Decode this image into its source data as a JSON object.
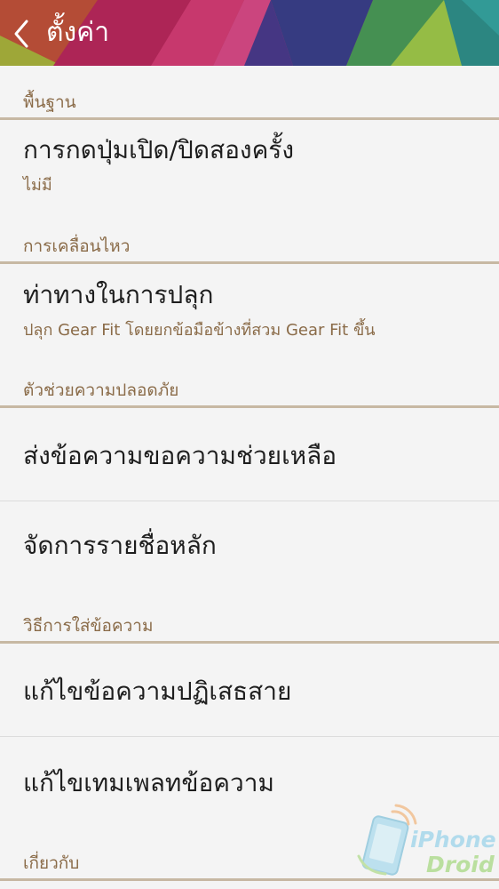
{
  "header": {
    "title": "ตั้งค่า",
    "back_icon": "chevron-left-icon"
  },
  "sections": [
    {
      "label": "พื้นฐาน",
      "items": [
        {
          "title": "การกดปุ่มเปิด/ปิดสองครั้ง",
          "subtitle": "ไม่มี"
        }
      ]
    },
    {
      "label": "การเคลื่อนไหว",
      "items": [
        {
          "title": "ท่าทางในการปลุก",
          "subtitle": "ปลุก Gear Fit โดยยกข้อมือข้างที่สวม Gear Fit ขึ้น"
        }
      ]
    },
    {
      "label": "ตัวช่วยความปลอดภัย",
      "items": [
        {
          "title": "ส่งข้อความขอความช่วยเหลือ"
        },
        {
          "title": "จัดการรายชื่อหลัก"
        }
      ]
    },
    {
      "label": "วิธีการใส่ข้อความ",
      "items": [
        {
          "title": "แก้ไขข้อความปฏิเสธสาย"
        },
        {
          "title": "แก้ไขเทมเพลทข้อความ"
        }
      ]
    },
    {
      "label": "เกี่ยวกับ",
      "items": []
    }
  ],
  "watermark": {
    "line1": "iPhone",
    "line2": "Droid"
  },
  "colors": {
    "section_label": "#8a6b48",
    "section_rule": "#c7b8a3",
    "background": "#f4f4f4",
    "item_title": "#1e1e1e"
  }
}
